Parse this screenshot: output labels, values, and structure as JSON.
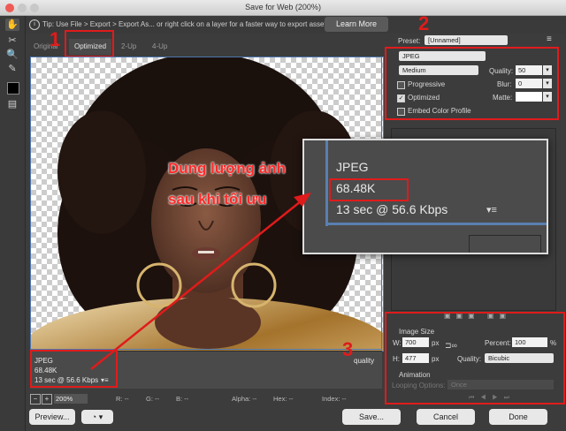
{
  "window": {
    "title": "Save for Web (200%)"
  },
  "tip": {
    "text": "Tip: Use File > Export > Export As... or right click on a layer for a faster way to export assets",
    "learn_more": "Learn More"
  },
  "tabs": [
    {
      "label": "Original"
    },
    {
      "label": "Optimized",
      "selected": true
    },
    {
      "label": "2-Up"
    },
    {
      "label": "4-Up"
    }
  ],
  "annotations": {
    "n1": "1",
    "n2": "2",
    "n3": "3",
    "caption_line1": "Dung lượng ảnh",
    "caption_line2": "sau khi tối ưu",
    "accent": "#e01b1b"
  },
  "preview_info": {
    "format": "JPEG",
    "size": "68.48K",
    "time": "13 sec @ 56.6 Kbps",
    "quality_partial": "quality"
  },
  "zoom_info": {
    "format": "JPEG",
    "size": "68.48K",
    "time": "13 sec @ 56.6 Kbps"
  },
  "status": {
    "zoom": "200%",
    "r": "R: --",
    "g": "G: --",
    "b": "B: --",
    "alpha": "Alpha: --",
    "hex": "Hex: --",
    "index": "Index: --"
  },
  "settings": {
    "preset_label": "Preset:",
    "preset_value": "[Unnamed]",
    "format": "JPEG",
    "quality_level": "Medium",
    "quality_label": "Quality:",
    "quality_value": "50",
    "progressive": "Progressive",
    "blur_label": "Blur:",
    "blur_value": "0",
    "optimized": "Optimized",
    "matte_label": "Matte:",
    "embed": "Embed Color Profile"
  },
  "image_size": {
    "heading": "Image Size",
    "w_label": "W:",
    "w_value": "700",
    "h_label": "H:",
    "h_value": "477",
    "unit": "px",
    "percent_label": "Percent:",
    "percent_value": "100",
    "percent_unit": "%",
    "quality_label": "Quality:",
    "quality_value": "Bicubic"
  },
  "animation": {
    "heading": "Animation",
    "looping_label": "Looping Options:",
    "looping_value": "Once"
  },
  "buttons": {
    "preview": "Preview...",
    "save": "Save...",
    "cancel": "Cancel",
    "done": "Done"
  }
}
